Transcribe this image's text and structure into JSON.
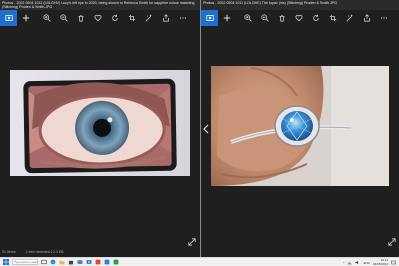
{
  "left_window": {
    "title_line1": "Photos - 2022 0504 1012 (LDLGHV) Lucy's left eye in 2020, being shown to Rebecca Smith for sapphire colour matching",
    "title_line2": "(Stitching) Pruden & Smith.JPG",
    "status_count": "51 items",
    "status_selected": "1 item selected  12.4 KB"
  },
  "right_window": {
    "title_line1": "Photos - 2022 0504 1011 (LDLGHE) The topaz (iris) (Stitching) Pruden & Smith.JPG"
  },
  "toolbar_icons": [
    "photo-icon",
    "add-icon",
    "zoom-in-icon",
    "zoom-out-icon",
    "delete-icon",
    "heart-icon",
    "rotate-icon",
    "crop-icon",
    "enhance-icon",
    "share-icon",
    "more-icon"
  ],
  "taskbar": {
    "search_placeholder": "Type here to search",
    "time": "10:11",
    "date": "04/05/2022",
    "language": "ENG"
  },
  "colors": {
    "accent": "#1f6fd1",
    "pane_bg": "#1f1f1f"
  }
}
